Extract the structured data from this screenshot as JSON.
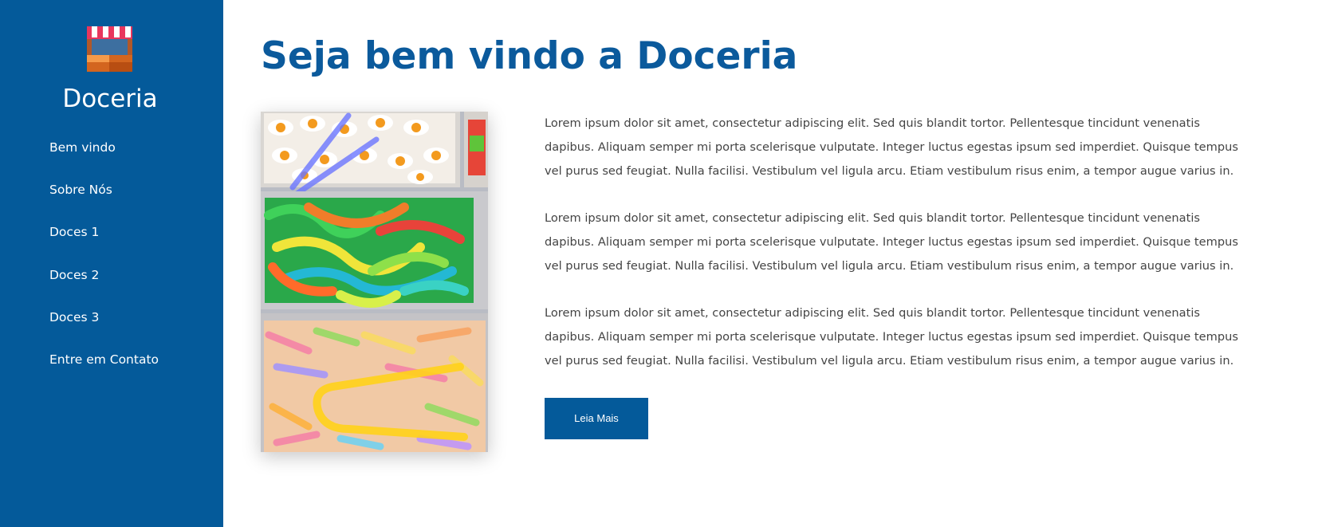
{
  "sidebar": {
    "logo_icon": "market-stall-icon",
    "brand": "Doceria",
    "nav": [
      {
        "label": "Bem vindo"
      },
      {
        "label": "Sobre Nós"
      },
      {
        "label": "Doces 1"
      },
      {
        "label": "Doces 2"
      },
      {
        "label": "Doces 3"
      },
      {
        "label": "Entre em Contato"
      }
    ]
  },
  "main": {
    "title": "Seja bem vindo a Doceria",
    "image": {
      "description_icon": "gummy-candy-photo"
    },
    "paragraphs": [
      "Lorem ipsum dolor sit amet, consectetur adipiscing elit. Sed quis blandit tortor. Pellentesque tincidunt venenatis dapibus. Aliquam semper mi porta scelerisque vulputate. Integer luctus egestas ipsum sed imperdiet. Quisque tempus vel purus sed feugiat. Nulla facilisi. Vestibulum vel ligula arcu. Etiam vestibulum risus enim, a tempor augue varius in.",
      "Lorem ipsum dolor sit amet, consectetur adipiscing elit. Sed quis blandit tortor. Pellentesque tincidunt venenatis dapibus. Aliquam semper mi porta scelerisque vulputate. Integer luctus egestas ipsum sed imperdiet. Quisque tempus vel purus sed feugiat. Nulla facilisi. Vestibulum vel ligula arcu. Etiam vestibulum risus enim, a tempor augue varius in.",
      "Lorem ipsum dolor sit amet, consectetur adipiscing elit. Sed quis blandit tortor. Pellentesque tincidunt venenatis dapibus. Aliquam semper mi porta scelerisque vulputate. Integer luctus egestas ipsum sed imperdiet. Quisque tempus vel purus sed feugiat. Nulla facilisi. Vestibulum vel ligula arcu. Etiam vestibulum risus enim, a tempor augue varius in."
    ],
    "button_label": "Leia Mais"
  },
  "colors": {
    "sidebar_bg": "#045a9a",
    "title": "#0b5a9c",
    "button_bg": "#045a9a",
    "body_text": "#444444"
  }
}
